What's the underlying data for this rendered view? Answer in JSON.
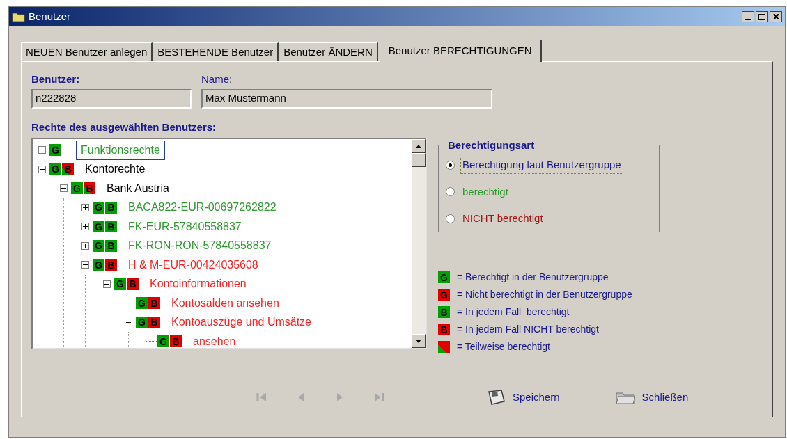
{
  "window": {
    "title": "Benutzer"
  },
  "tabs": [
    {
      "label": "NEUEN Benutzer anlegen",
      "selected": false
    },
    {
      "label": "BESTEHENDE Benutzer",
      "selected": false
    },
    {
      "label": "Benutzer ÄNDERN",
      "selected": false
    },
    {
      "label": "Benutzer BERECHTIGUNGEN",
      "selected": true
    }
  ],
  "fields": [
    {
      "label": "Benutzer:",
      "value": "n222828",
      "bold": true
    },
    {
      "label": "Name:",
      "value": "Max Mustermann",
      "bold": false
    }
  ],
  "tree": {
    "label": "Rechte des ausgewählten Benutzers:",
    "nodes": [
      {
        "text": "Funktionsrechte",
        "color": "#2e9a2e",
        "expanded": false,
        "selected": true,
        "badges": [
          {
            "letter": "G",
            "color": "#00a000"
          }
        ]
      },
      {
        "text": "Kontorechte",
        "color": "#000000",
        "expanded": true,
        "selected": false,
        "badges": [
          {
            "letter": "G",
            "color": "#00a000"
          },
          {
            "letter": "B",
            "color": "#e00000",
            "partial": true
          }
        ],
        "children": [
          {
            "text": "Bank Austria",
            "color": "#000000",
            "expanded": true,
            "selected": false,
            "badges": [
              {
                "letter": "G",
                "color": "#00a000"
              },
              {
                "letter": "B",
                "color": "#e00000",
                "partial": true
              }
            ],
            "children": [
              {
                "text": "BACA822-EUR-00697262822",
                "color": "#2e9a2e",
                "expanded": false,
                "selected": false,
                "badges": [
                  {
                    "letter": "G",
                    "color": "#00a000"
                  },
                  {
                    "letter": "B",
                    "color": "#00a000"
                  }
                ]
              },
              {
                "text": "FK-EUR-57840558837",
                "color": "#2e9a2e",
                "expanded": false,
                "selected": false,
                "badges": [
                  {
                    "letter": "G",
                    "color": "#00a000"
                  },
                  {
                    "letter": "B",
                    "color": "#00a000"
                  }
                ]
              },
              {
                "text": "FK-RON-RON-57840558837",
                "color": "#2e9a2e",
                "expanded": false,
                "selected": false,
                "badges": [
                  {
                    "letter": "G",
                    "color": "#00a000"
                  },
                  {
                    "letter": "B",
                    "color": "#00a000"
                  }
                ]
              },
              {
                "text": "H & M-EUR-00424035608",
                "color": "#ff2020",
                "expanded": true,
                "selected": false,
                "badges": [
                  {
                    "letter": "G",
                    "color": "#00a000"
                  },
                  {
                    "letter": "B",
                    "color": "#e00000"
                  }
                ],
                "children": [
                  {
                    "text": "Kontoinformationen",
                    "color": "#ff2020",
                    "expanded": true,
                    "selected": false,
                    "badges": [
                      {
                        "letter": "G",
                        "color": "#00a000"
                      },
                      {
                        "letter": "B",
                        "color": "#e00000"
                      }
                    ],
                    "children": [
                      {
                        "text": "Kontosalden ansehen",
                        "color": "#ff2020",
                        "selected": false,
                        "badges": [
                          {
                            "letter": "G",
                            "color": "#00a000"
                          },
                          {
                            "letter": "B",
                            "color": "#e00000"
                          }
                        ]
                      },
                      {
                        "text": "Kontoauszüge und Umsätze",
                        "color": "#ff2020",
                        "expanded": true,
                        "selected": false,
                        "badges": [
                          {
                            "letter": "G",
                            "color": "#00a000"
                          },
                          {
                            "letter": "B",
                            "color": "#e00000"
                          }
                        ],
                        "children": [
                          {
                            "text": "ansehen",
                            "color": "#ff2020",
                            "selected": false,
                            "badges": [
                              {
                                "letter": "G",
                                "color": "#00a000"
                              },
                              {
                                "letter": "B",
                                "color": "#e00000"
                              }
                            ]
                          }
                        ]
                      }
                    ]
                  }
                ]
              }
            ]
          }
        ]
      }
    ]
  },
  "permission_type": {
    "title": "Berechtigungsart",
    "options": [
      {
        "label": "Berechtigung laut Benutzergruppe",
        "color": "#1a1a8c",
        "selected": true,
        "focused": true
      },
      {
        "label": "berechtigt",
        "color": "#2e9a2e",
        "selected": false,
        "focused": false
      },
      {
        "label": "NICHT berechtigt",
        "color": "#a01818",
        "selected": false,
        "focused": false
      }
    ]
  },
  "legend": [
    {
      "letter": "G",
      "color": "#00a000",
      "text": "= Berechtigt in der Benutzergruppe"
    },
    {
      "letter": "G",
      "color": "#e00000",
      "text": "= Nicht berechtigt in der Benutzergruppe"
    },
    {
      "letter": "B",
      "color": "#00a000",
      "text": "= In jedem Fall  berechtigt"
    },
    {
      "letter": "B",
      "color": "#e00000",
      "text": "= In jedem Fall NICHT berechtigt"
    },
    {
      "color": "#e00000",
      "partial": true,
      "text": "= Teilweise berechtigt"
    }
  ],
  "navigation": [
    {
      "kind": "first",
      "disabled": true
    },
    {
      "kind": "previous",
      "disabled": true
    },
    {
      "kind": "next",
      "disabled": true
    },
    {
      "kind": "last",
      "disabled": true
    }
  ],
  "actions": [
    {
      "kind": "save",
      "label": "Speichern"
    },
    {
      "kind": "close",
      "label": "Schließen"
    }
  ]
}
